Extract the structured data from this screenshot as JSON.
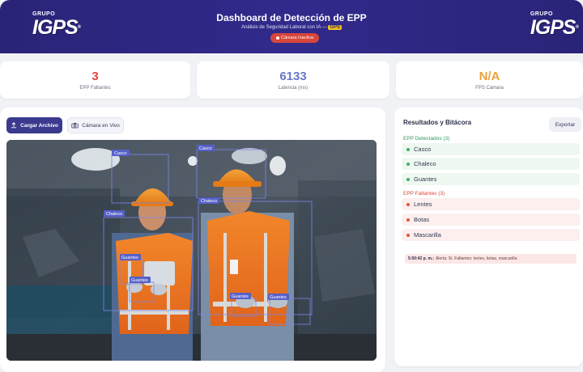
{
  "header": {
    "title": "Dashboard de Detección de EPP",
    "subtitle": "Análisis de Seguridad Laboral con IA —",
    "subtitle_tag": "GPS",
    "camera_status": "Cámara Inactiva",
    "logo_small": "GRUPO",
    "logo_big": "IGPS",
    "logo_mark": "®"
  },
  "metrics": [
    {
      "value": "3",
      "label": "EPP Faltantes",
      "color": "#e0473d"
    },
    {
      "value": "6133",
      "label": "Latencia (ms)",
      "color": "#6776c9"
    },
    {
      "value": "N/A",
      "label": "FPS Cámara",
      "color": "#e9a13a"
    }
  ],
  "controls": {
    "upload_label": "Cargar Archivo",
    "live_label": "Cámara en Vivo"
  },
  "detections": [
    {
      "label": "Casco"
    },
    {
      "label": "Casco"
    },
    {
      "label": "Chaleco"
    },
    {
      "label": "Chaleco"
    },
    {
      "label": "Guantes"
    },
    {
      "label": "Guantes"
    },
    {
      "label": "Guantes"
    },
    {
      "label": "Guantes"
    }
  ],
  "results": {
    "title": "Resultados y Bitácora",
    "export_label": "Exportar",
    "detected_header": "EPP Detectados (3)",
    "detected": [
      "Casco",
      "Chaleco",
      "Guantes"
    ],
    "missing_header": "EPP Faltantes (3)",
    "missing": [
      "Lentes",
      "Botas",
      "Mascarilla"
    ],
    "log_time": "5:50:42 p. m.:",
    "log_text": "Alerta: Sí. Faltantes: lentes, botas, mascarilla."
  },
  "icons": {
    "upload": "upload-icon",
    "camera": "camera-icon",
    "status": "status-dot-icon",
    "check": "check-icon",
    "alert": "alert-dot-icon"
  }
}
